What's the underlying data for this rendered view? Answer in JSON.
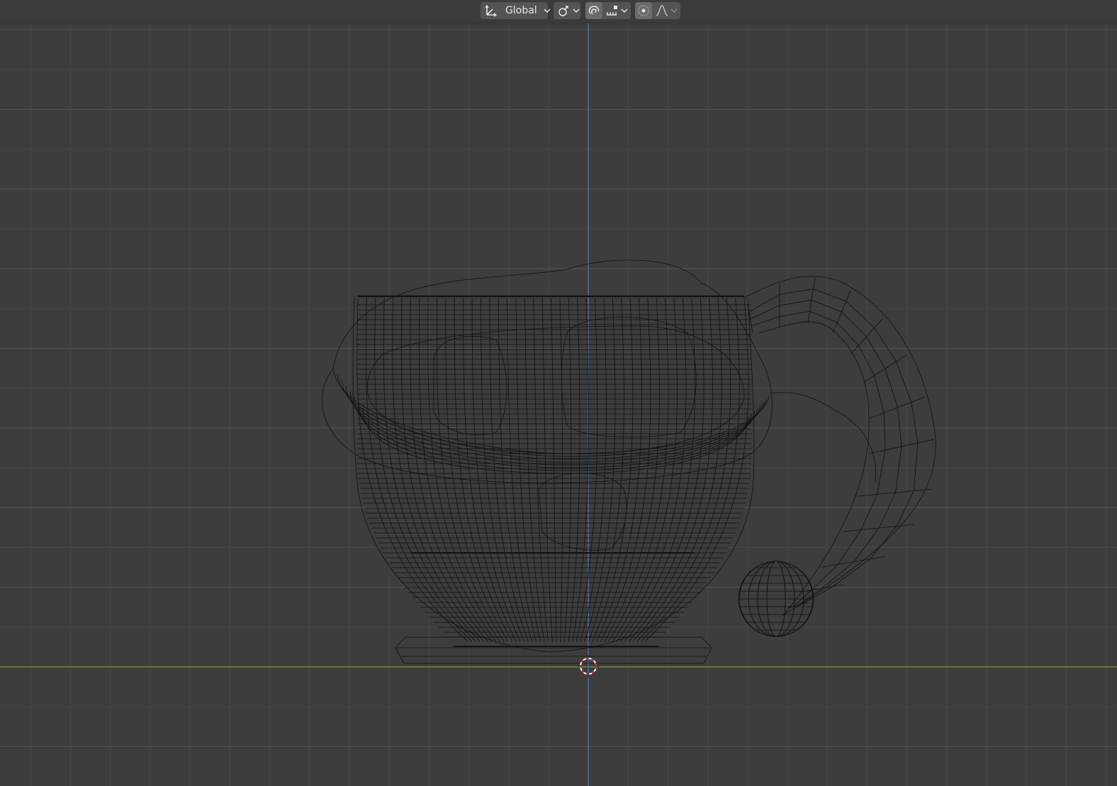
{
  "header": {
    "transform_orientation": {
      "icon": "transform-orientation-icon",
      "label": "Global",
      "dropdown_icon": "chevron-down-icon"
    },
    "pivot_point": {
      "icon": "pivot-point-icon",
      "dropdown_icon": "chevron-down-icon"
    },
    "snapping": {
      "toggle_icon": "magnet-icon",
      "toggle_active": true,
      "target_icon": "snap-increment-icon",
      "dropdown_icon": "chevron-down-icon"
    },
    "proportional_editing": {
      "toggle_icon": "proportional-edit-icon",
      "falloff_icon": "falloff-curve-icon",
      "dropdown_icon": "chevron-down-icon"
    }
  },
  "viewport": {
    "background_color": "#3d3d3d",
    "grid_minor_color": "#474747",
    "grid_major_color": "#565656",
    "x_axis_color": "#6f8b3a",
    "z_axis_color": "#4a6ea0",
    "wire_color": "#111111",
    "object_name_icon": "teacup-wireframe",
    "cursor_icon": "3d-cursor-icon"
  }
}
